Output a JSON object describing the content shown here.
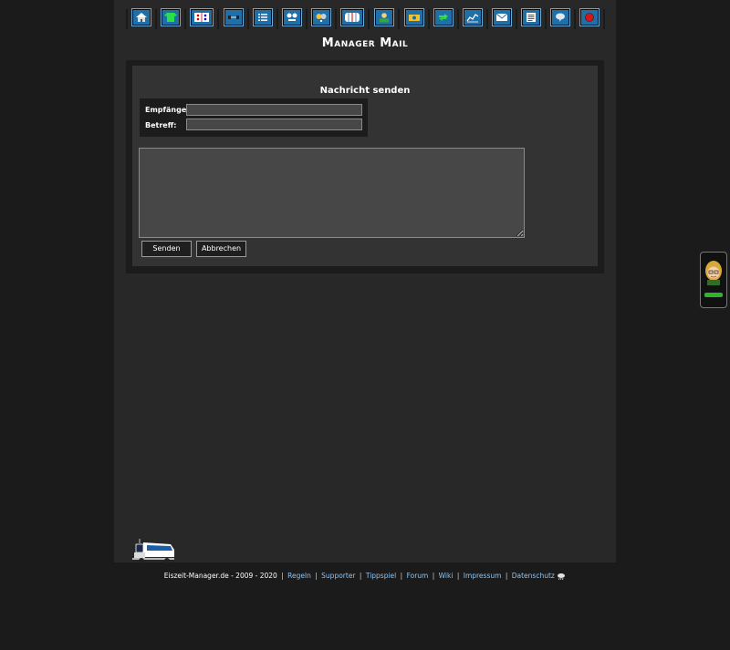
{
  "page": {
    "title": "Manager Mail"
  },
  "nav": {
    "icons": [
      "home-icon",
      "shirt-icon",
      "lineup-icon",
      "training-icon",
      "list-icon",
      "match-icon",
      "trophy-icon",
      "arena-icon",
      "manager-icon",
      "finance-icon",
      "transfer-icon",
      "stats-icon",
      "mail-icon",
      "news-icon",
      "chat-icon",
      "logout-icon"
    ]
  },
  "form": {
    "heading": "Nachricht senden",
    "recipient_label": "Empfänger:",
    "recipient_value": "",
    "subject_label": "Betreff:",
    "subject_value": "",
    "message_value": "",
    "send_label": "Senden",
    "cancel_label": "Abbrechen"
  },
  "footer": {
    "copyright": "Eiszeit-Manager.de - 2009 - 2020",
    "links": [
      "Regeln",
      "Supporter",
      "Tippspiel",
      "Forum",
      "Wiki",
      "Impressum",
      "Datenschutz"
    ]
  },
  "colors": {
    "background": "#1b1b1b",
    "page": "#282828",
    "panel": "#333333",
    "nav_button": "#1f6fa8",
    "link": "#8ec4f2"
  }
}
